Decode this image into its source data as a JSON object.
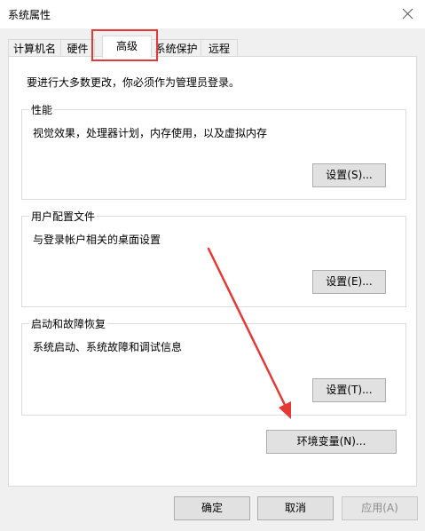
{
  "window": {
    "title": "系统属性"
  },
  "tabs": [
    {
      "label": "计算机名"
    },
    {
      "label": "硬件"
    },
    {
      "label": "高级"
    },
    {
      "label": "系统保护"
    },
    {
      "label": "远程"
    }
  ],
  "advanced": {
    "notice": "要进行大多数更改，你必须作为管理员登录。",
    "performance": {
      "title": "性能",
      "description": "视觉效果，处理器计划，内存使用，以及虚拟内存",
      "button": "设置(S)..."
    },
    "user_profiles": {
      "title": "用户配置文件",
      "description": "与登录帐户相关的桌面设置",
      "button": "设置(E)..."
    },
    "startup_recovery": {
      "title": "启动和故障恢复",
      "description": "系统启动、系统故障和调试信息",
      "button": "设置(T)..."
    },
    "env_button": "环境变量(N)..."
  },
  "footer": {
    "ok": "确定",
    "cancel": "取消",
    "apply": "应用(A)"
  },
  "colors": {
    "annotation": "#e53935"
  }
}
